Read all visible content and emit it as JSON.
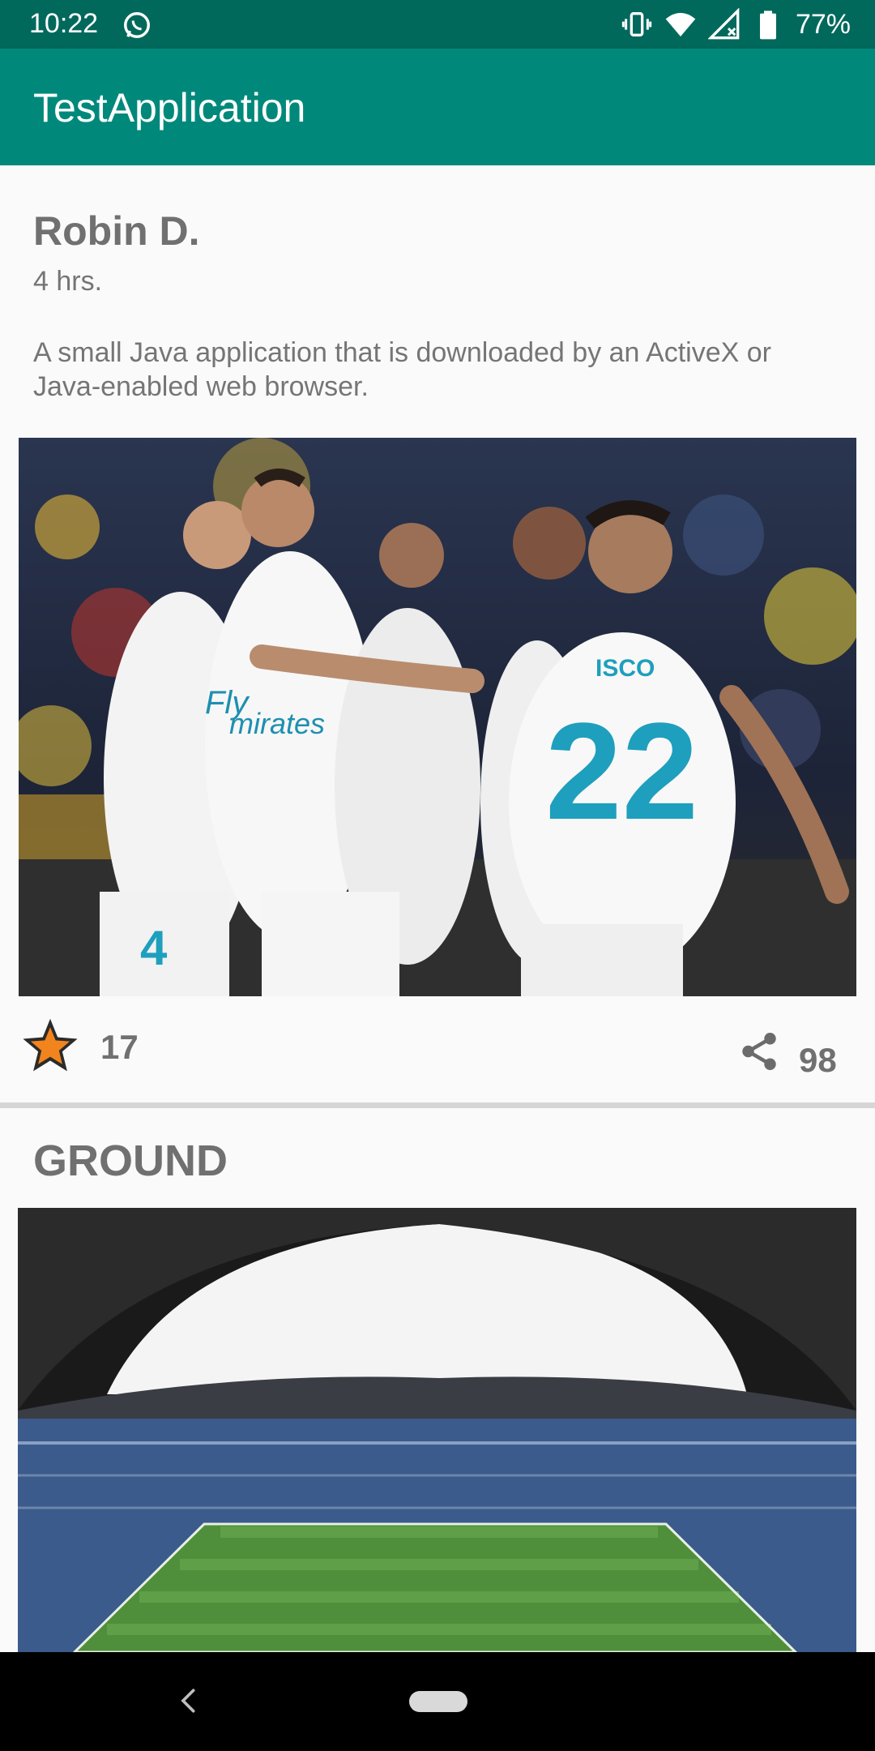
{
  "status_bar": {
    "time": "10:22",
    "left_icon": "whatsapp-icon",
    "right_icons": [
      "vibrate-icon",
      "wifi-icon",
      "signal-icon",
      "battery-icon"
    ],
    "battery": "77%"
  },
  "app_bar": {
    "title": "TestApplication",
    "color": "#00897b"
  },
  "post": {
    "author": "Robin D.",
    "time": "4 hrs.",
    "description": "A small Java application that is downloaded by an ActiveX or Java-enabled web browser.",
    "image": "football-players-celebrating-photo",
    "likes": "17",
    "shares": "98",
    "like_icon": "star-icon",
    "share_icon": "share-icon"
  },
  "post2": {
    "title": "GROUND",
    "image": "stadium-photo"
  },
  "nav_bar": {
    "back_icon": "back-icon",
    "home_icon": "home-pill-icon"
  }
}
